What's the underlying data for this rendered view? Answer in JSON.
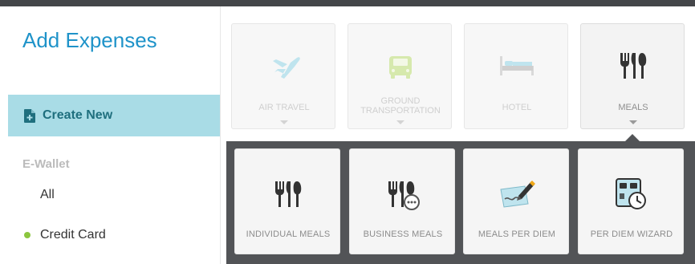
{
  "sidebar": {
    "title": "Add Expenses",
    "create_new_label": "Create New",
    "ewallet_heading": "E-Wallet",
    "ewallet_items": [
      "All",
      "Credit Card"
    ]
  },
  "categories": [
    {
      "label": "AIR TRAVEL",
      "icon": "airplane-icon"
    },
    {
      "label": "GROUND TRANSPORTATION",
      "icon": "car-icon"
    },
    {
      "label": "HOTEL",
      "icon": "bed-icon"
    },
    {
      "label": "MEALS",
      "icon": "utensils-icon",
      "active": true
    }
  ],
  "meals_submenu": [
    {
      "label": "INDIVIDUAL MEALS",
      "icon": "utensils-icon"
    },
    {
      "label": "BUSINESS MEALS",
      "icon": "utensils-chat-icon"
    },
    {
      "label": "MEALS PER DIEM",
      "icon": "signature-icon"
    },
    {
      "label": "PER DIEM WIZARD",
      "icon": "wizard-icon"
    }
  ],
  "colors": {
    "accent": "#1f93c9",
    "create_new_bg": "#a9dce6",
    "submenu_bg": "#525457",
    "credit_card_dot": "#8cc63f"
  }
}
